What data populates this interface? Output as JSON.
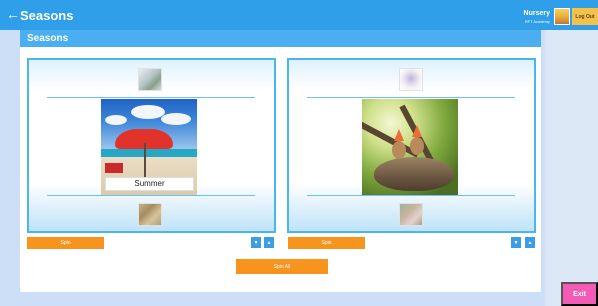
{
  "app": {
    "back_glyph": "←",
    "title": "Seasons",
    "user_name": "Nursery",
    "user_org": "RFT Academy",
    "logout_label": "Log Out",
    "exit_label": "Exit"
  },
  "window": {
    "title": "Seasons"
  },
  "slots": [
    {
      "top_thumb_icon": "snowy-field-thumbnail",
      "main_image_icon": "beach-umbrella-image",
      "caption": "Summer",
      "bottom_thumb_icon": "autumn-leaves-thumbnail",
      "spin_label": "Spin",
      "down_glyph": "▼",
      "up_glyph": "▲"
    },
    {
      "top_thumb_icon": "flower-thumbnail",
      "main_image_icon": "baby-birds-nest-image",
      "caption": "",
      "bottom_thumb_icon": "blossom-thumbnail",
      "spin_label": "Spin",
      "down_glyph": "▼",
      "up_glyph": "▲"
    }
  ],
  "spin_all_label": "Spin All",
  "colors": {
    "topbar": "#2f9fe9",
    "window_header": "#4aaef1",
    "panel_border": "#49b6ef",
    "spin_button": "#f7941d",
    "arrow_button": "#3a9de6",
    "exit_button": "#f35bb7",
    "logout_button": "#f4c14a"
  }
}
